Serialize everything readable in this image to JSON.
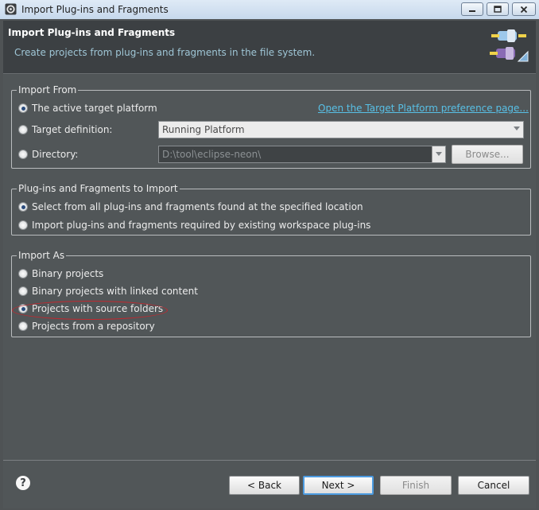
{
  "window": {
    "title": "Import Plug-ins and Fragments",
    "icon": "eclipse-gear-icon"
  },
  "banner": {
    "title": "Import Plug-ins and Fragments",
    "subtitle": "Create projects from plug-ins and fragments in the file system.",
    "image": "plugin-import-wizard-icon"
  },
  "import_from": {
    "legend": "Import From",
    "options": [
      {
        "label": "The active target platform",
        "checked": true
      },
      {
        "label": "Target definition:",
        "checked": false
      },
      {
        "label": "Directory:",
        "checked": false
      }
    ],
    "preference_link": "Open the Target Platform preference page...",
    "target_definition_value": "Running Platform",
    "directory_value": "D:\\tool\\eclipse-neon\\",
    "browse_label": "Browse..."
  },
  "plugins_to_import": {
    "legend": "Plug-ins and Fragments to Import",
    "options": [
      {
        "label": "Select from all plug-ins and fragments found at the specified location",
        "checked": true
      },
      {
        "label": "Import plug-ins and fragments required by existing workspace plug-ins",
        "checked": false
      }
    ]
  },
  "import_as": {
    "legend": "Import As",
    "options": [
      {
        "label": "Binary projects",
        "checked": false
      },
      {
        "label": "Binary projects with linked content",
        "checked": false
      },
      {
        "label": "Projects with source folders",
        "checked": true
      },
      {
        "label": "Projects from a repository",
        "checked": false
      }
    ]
  },
  "footer": {
    "help_glyph": "?",
    "back_label": "< Back",
    "next_label": "Next >",
    "finish_label": "Finish",
    "cancel_label": "Cancel"
  },
  "colors": {
    "annotation": "#c2282f",
    "link": "#58c0e6",
    "default_button_border": "#4c9be0"
  }
}
